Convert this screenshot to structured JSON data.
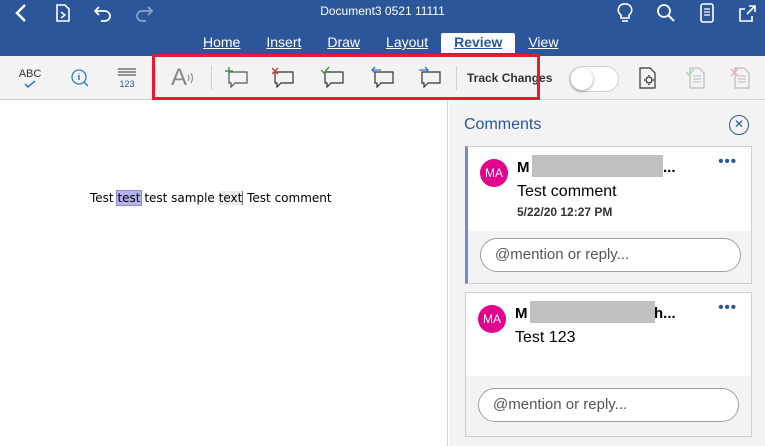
{
  "window": {
    "title": "Document3 0521 11111"
  },
  "tabs": [
    "Home",
    "Insert",
    "Draw",
    "Layout",
    "Review",
    "View"
  ],
  "active_tab": "Review",
  "ribbon": {
    "spelling_label": "ABC",
    "word_count_label": "123",
    "read_aloud_label": "A",
    "track_changes_label": "Track Changes",
    "track_changes_on": false
  },
  "document": {
    "text_before": "Test ",
    "highlight1": "test",
    "text_middle": " test sample ",
    "highlight2": "text",
    "text_after": " Test comment"
  },
  "comments_pane": {
    "title": "Comments",
    "comments": [
      {
        "initials": "MA",
        "author_first": "M",
        "author_tail": "...",
        "text": "Test comment",
        "timestamp": "5/22/20 12:27 PM",
        "reply_placeholder": "@mention or reply..."
      },
      {
        "initials": "MA",
        "author_first": "M",
        "author_tail": "h...",
        "text": "Test 123",
        "reply_placeholder": "@mention or reply..."
      }
    ]
  },
  "more_glyph": "•••",
  "colors": {
    "accent": "#2b579a",
    "avatar": "#e3008c",
    "highlight_box": "#e01e2c"
  }
}
